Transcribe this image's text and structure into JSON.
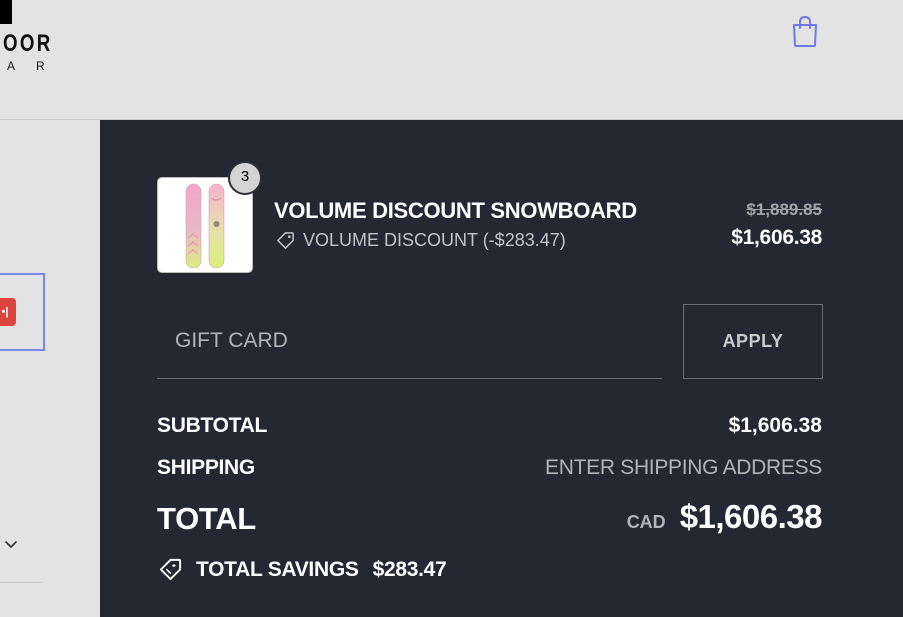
{
  "header": {
    "logo_line1": "OOR",
    "logo_line2": "AR",
    "bag_icon": "shopping-bag-icon"
  },
  "left_panel": {
    "red_badge": "•|",
    "chevron_icon": "chevron-down-icon"
  },
  "line_item": {
    "quantity": "3",
    "title": "VOLUME DISCOUNT SNOWBOARD",
    "discount_label": "VOLUME DISCOUNT (-$283.47)",
    "discount_icon": "tag-icon",
    "price_original": "$1,889.85",
    "price_final": "$1,606.38"
  },
  "gift_card": {
    "placeholder": "GIFT CARD",
    "apply_label": "APPLY"
  },
  "summary": {
    "subtotal_label": "SUBTOTAL",
    "subtotal_value": "$1,606.38",
    "shipping_label": "SHIPPING",
    "shipping_value": "ENTER SHIPPING ADDRESS",
    "total_label": "TOTAL",
    "currency": "CAD",
    "total_value": "$1,606.38",
    "savings_label": "TOTAL SAVINGS",
    "savings_value": "$283.47"
  },
  "colors": {
    "summary_bg": "#252833",
    "header_bg": "#e3e3e3",
    "accent_focus": "#7b86e6",
    "bag_icon": "#6f7ae8"
  }
}
